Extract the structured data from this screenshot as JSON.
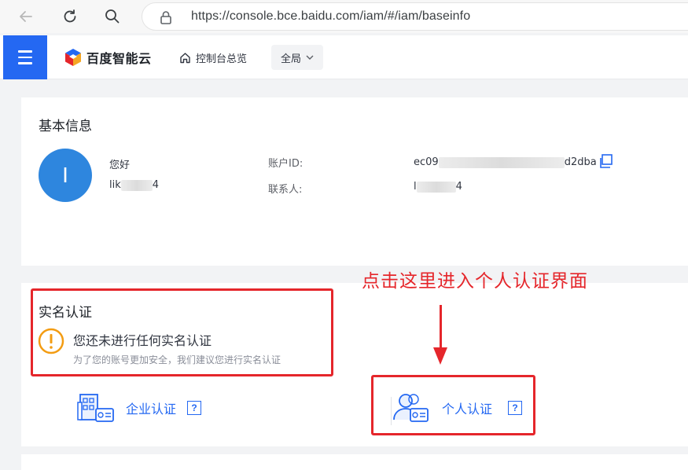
{
  "browser": {
    "url": "https://console.bce.baidu.com/iam/#/iam/baseinfo"
  },
  "header": {
    "logo_text": "百度智能云",
    "home_label": "控制台总览",
    "region_label": "全局"
  },
  "basic_info": {
    "title": "基本信息",
    "avatar_letter": "I",
    "greeting": "您好",
    "username_prefix": "lik",
    "username_suffix": "4",
    "account_id_label": "账户ID:",
    "account_id_prefix": "ec09",
    "account_id_suffix": "d2dba",
    "contact_label": "联系人:",
    "contact_prefix": "l",
    "contact_suffix": "4"
  },
  "real_name": {
    "title": "实名认证",
    "warning": "您还未进行任何实名认证",
    "warning_sub": "为了您的账号更加安全，我们建议您进行实名认证",
    "enterprise_label": "企业认证",
    "personal_label": "个人认证",
    "help_glyph": "?"
  },
  "annotation": {
    "text": "点击这里进入个人认证界面"
  },
  "colors": {
    "primary": "#2468f2",
    "annotation_red": "#e5262b",
    "warning_orange": "#f39c12"
  }
}
